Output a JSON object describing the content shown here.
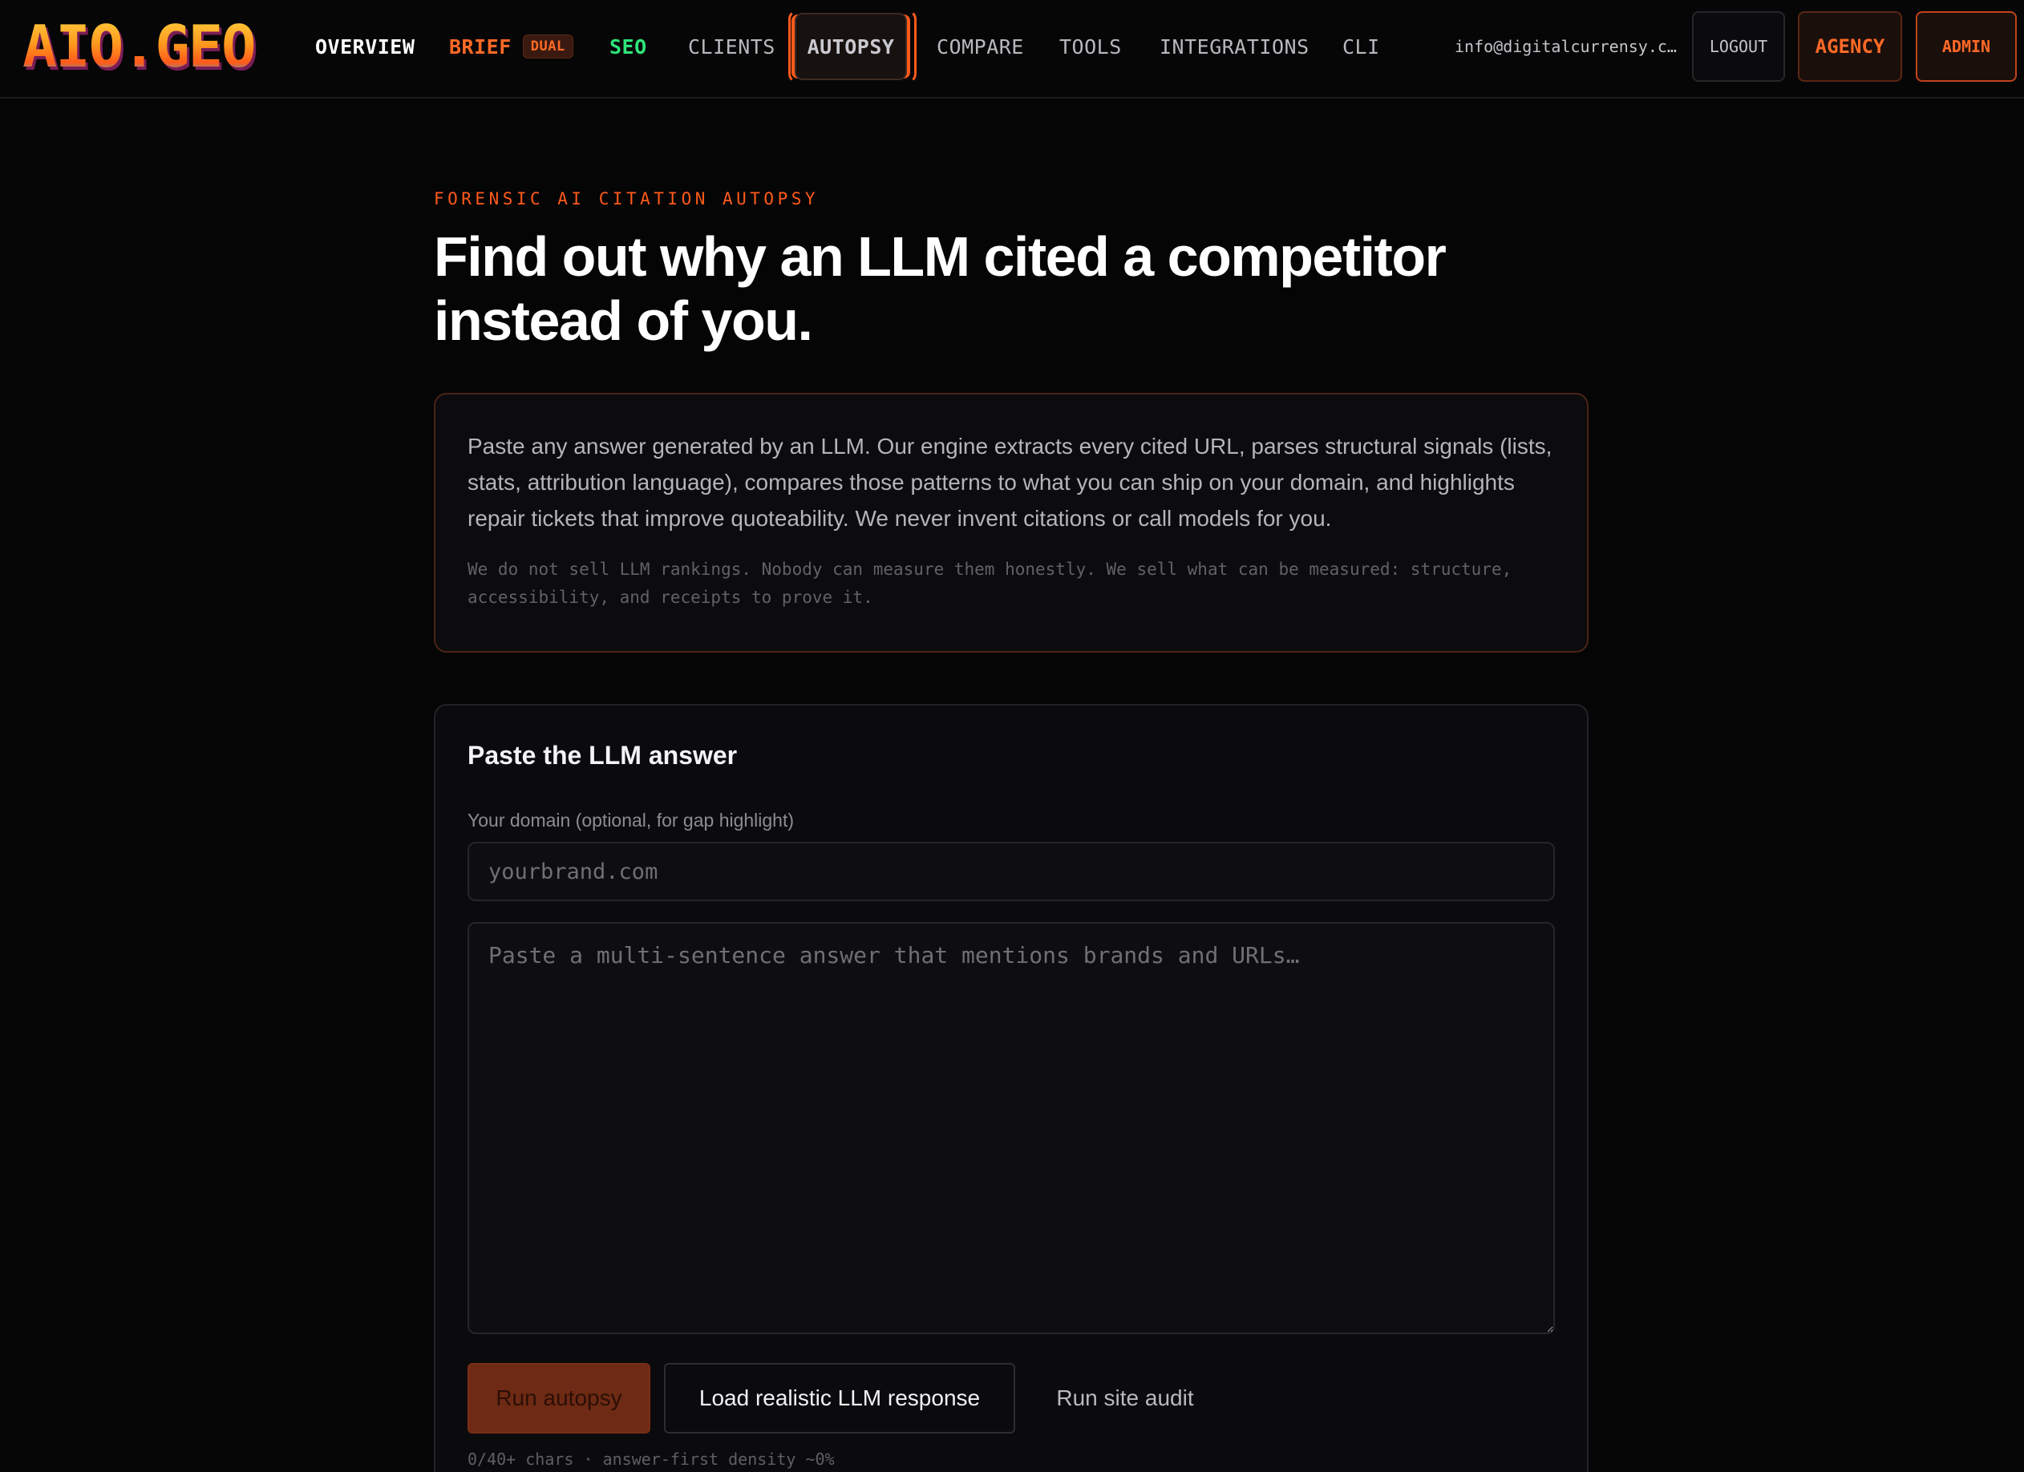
{
  "brand": {
    "logo_text": "AIO.GEO"
  },
  "nav": {
    "overview": "OVERVIEW",
    "brief": "BRIEF",
    "brief_badge": "DUAL",
    "seo": "SEO",
    "clients": "CLIENTS",
    "autopsy": "AUTOPSY",
    "compare": "COMPARE",
    "tools": "TOOLS",
    "integrations": "INTEGRATIONS",
    "cli": "CLI",
    "active": "AUTOPSY"
  },
  "account": {
    "email": "info@digitalcurrensy.c…",
    "logout": "LOGOUT",
    "agency": "AGENCY",
    "admin": "ADMIN"
  },
  "hero": {
    "eyebrow": "FORENSIC AI CITATION AUTOPSY",
    "headline": "Find out why an LLM cited a competitor instead of you."
  },
  "info": {
    "main": "Paste any answer generated by an LLM. Our engine extracts every cited URL, parses structural signals (lists, stats, attribution language), compares those patterns to what you can ship on your domain, and highlights repair tickets that improve quoteability. We never invent citations or call models for you.",
    "sub": "We do not sell LLM rankings. Nobody can measure them honestly. We sell what can be measured: structure, accessibility, and receipts to prove it."
  },
  "form": {
    "title": "Paste the LLM answer",
    "domain_label": "Your domain (optional, for gap highlight)",
    "domain_placeholder": "yourbrand.com",
    "domain_value": "",
    "answer_placeholder": "Paste a multi-sentence answer that mentions brands and URLs…",
    "answer_value": "",
    "run_button": "Run autopsy",
    "load_button": "Load realistic LLM response",
    "audit_button": "Run site audit",
    "status": "0/40+ chars · answer-first density ~0%"
  },
  "colors": {
    "accent": "#ff5a1a",
    "seo_green": "#2ee57a",
    "background": "#050506"
  }
}
